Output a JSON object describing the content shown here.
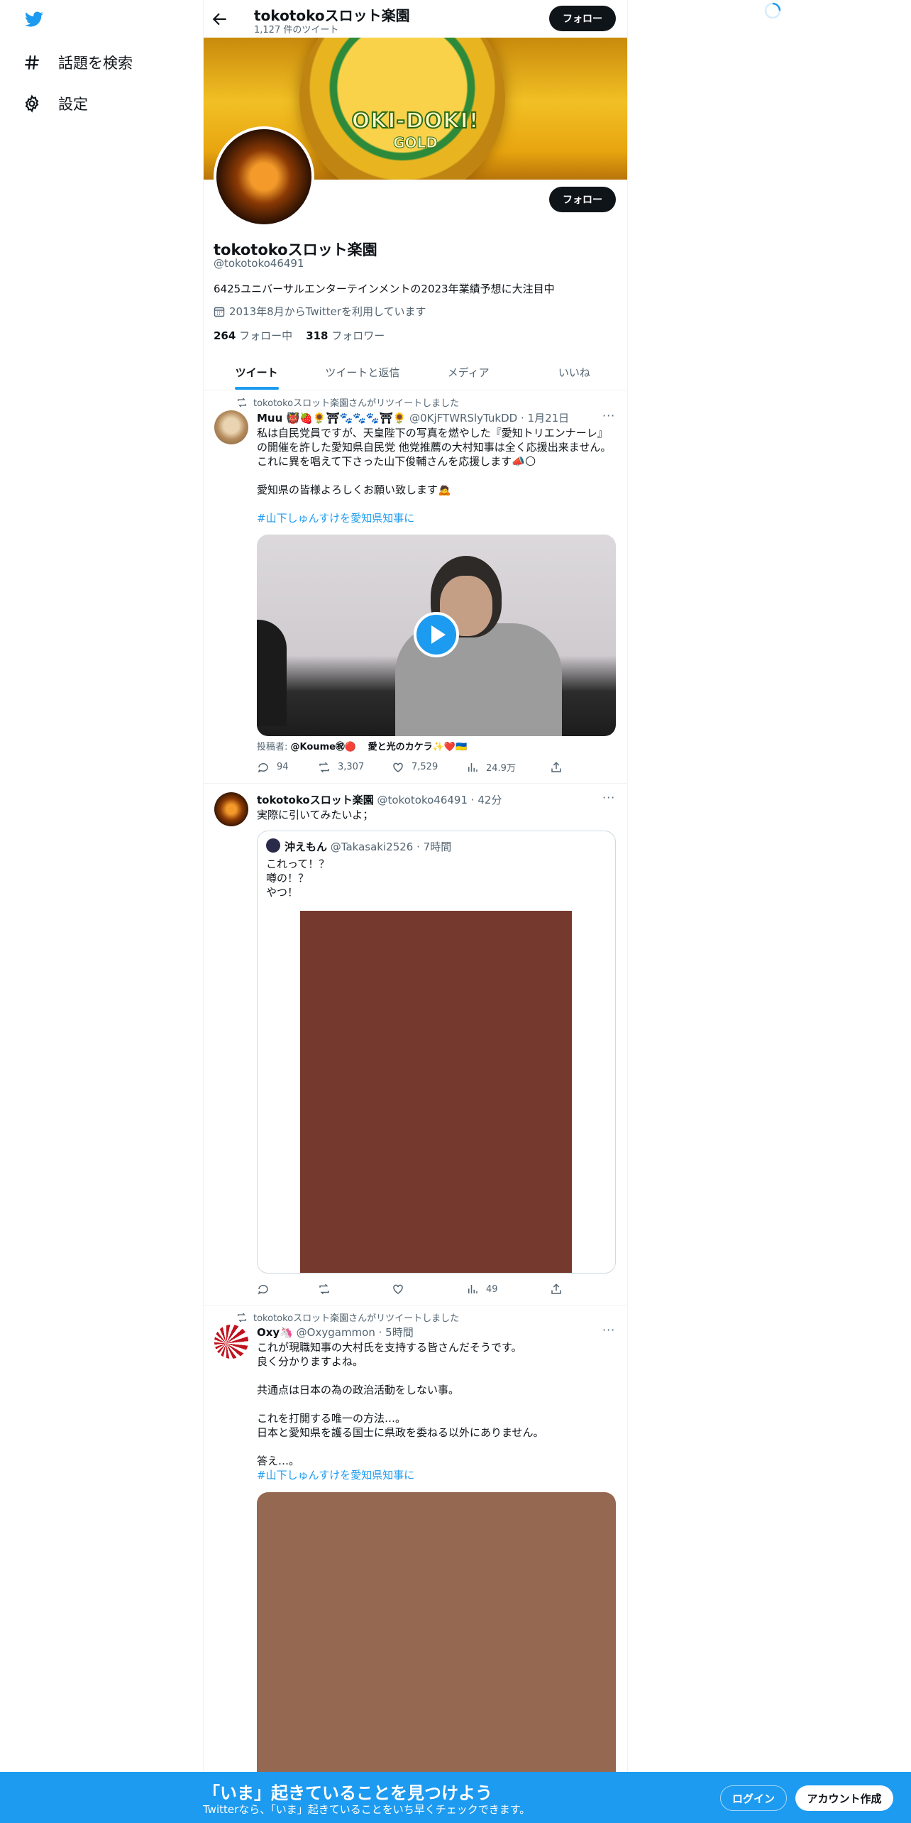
{
  "colors": {
    "accent": "#1d9bf0",
    "text": "#0f1419",
    "muted": "#536471"
  },
  "nav": {
    "items": [
      {
        "label": "話題を検索",
        "icon": "hashtag-icon"
      },
      {
        "label": "設定",
        "icon": "gear-icon"
      }
    ]
  },
  "header": {
    "name": "tokotokoスロット楽園",
    "tweet_count": "1,127 件のツイート",
    "follow_label": "フォロー"
  },
  "banner": {
    "text": "OKI-DOKI!",
    "sub": "GOLD"
  },
  "profile": {
    "name": "tokotokoスロット楽園",
    "handle": "@tokotoko46491",
    "bio": "6425ユニバーサルエンターテインメントの2023年業績予想に大注目中",
    "joined": "2013年8月からTwitterを利用しています",
    "following_count": "264",
    "following_label": "フォロー中",
    "followers_count": "318",
    "followers_label": "フォロワー",
    "follow_label": "フォロー"
  },
  "tabs": [
    "ツイート",
    "ツイートと返信",
    "メディア",
    "いいね"
  ],
  "tweets": [
    {
      "retweet_label": "tokotokoスロット楽園さんがリツイートしました",
      "author": "Muu 👹🍓🌻⛩🐾🐾🐾⛩🌻",
      "handle": "@0KjFTWRSlyTukDD",
      "time": "· 1月21日",
      "text": "私は自民党員ですが、天皇陛下の写真を燃やした『愛知トリエンナーレ』の開催を許した愛知県自民党 他党推薦の大村知事は全く応援出来ません。\nこれに異を唱えて下さった山下俊輔さんを応援します📣🌕\n\n愛知県の皆様よろしくお願い致します🙇",
      "hashtag": "#山下しゅんすけを愛知県知事に",
      "poster_label": "投稿者:",
      "poster1": "@Koume㊗🔴",
      "poster2": "愛と光のカケラ✨❤️🇺🇦",
      "replies": "94",
      "retweets": "3,307",
      "likes": "7,529",
      "views": "24.9万"
    },
    {
      "author": "tokotokoスロット楽園",
      "handle": "@tokotoko46491",
      "time": "· 42分",
      "text": "実際に引いてみたいよ；",
      "quote": {
        "author": "沖えもん",
        "handle": "@Takasaki2526",
        "time": "· 7時間",
        "text": "これって！？\n噂の！？\nやつ！"
      },
      "views": "49"
    },
    {
      "retweet_label": "tokotokoスロット楽園さんがリツイートしました",
      "author": "Oxy🦄",
      "handle": "@Oxygammon",
      "time": "· 5時間",
      "text": "これが現職知事の大村氏を支持する皆さんだそうです。\n良く分かりますよね。\n\n共通点は日本の為の政治活動をしない事。\n\nこれを打開する唯一の方法…。\n日本と愛知県を護る国士に県政を委ねる以外にありません。\n\n答え…。",
      "hashtag": "#山下しゅんすけを愛知県知事に"
    }
  ],
  "bottom": {
    "title": "「いま」起きていることを見つけよう",
    "subtitle": "Twitterなら、「いま」起きていることをいち早くチェックできます。",
    "login": "ログイン",
    "signup": "アカウント作成"
  }
}
